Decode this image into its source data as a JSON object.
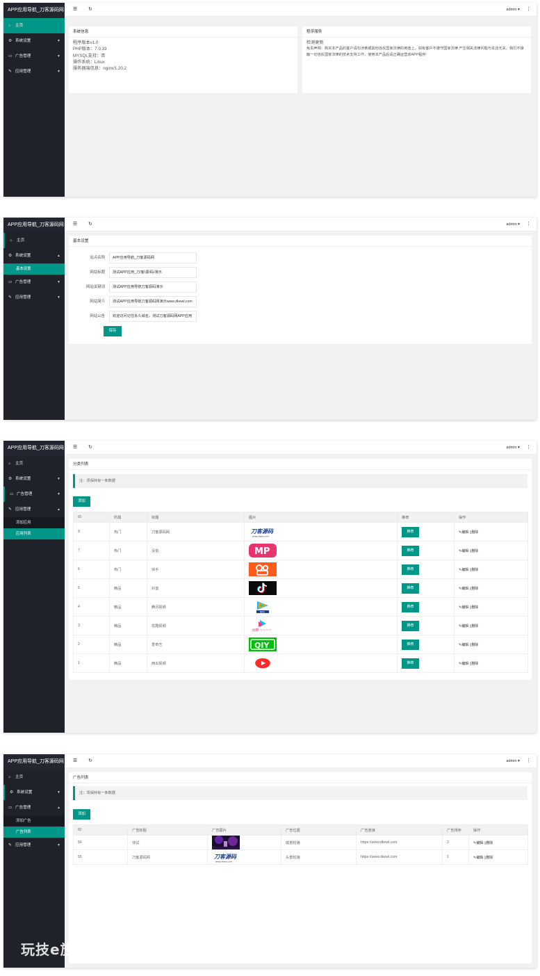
{
  "app": {
    "title": "APP应用导航_刀客源码网",
    "user": "admin ▾",
    "menu_icon": "hamburger-icon",
    "refresh_icon": "refresh-icon",
    "more_icon": "more-vert-icon"
  },
  "nav": {
    "home": "主页",
    "system": "系统设置",
    "ads": "广告管理",
    "apps": "应用管理",
    "sub_basic": "基本设置",
    "sub_add_app": "添加应用",
    "sub_app_list": "应用列表",
    "sub_add_ad": "添加广告",
    "sub_ad_list": "广告列表"
  },
  "dashboard": {
    "sysinfo_title": "系统信息",
    "sysinfo_lines": [
      "程序版本v1.0",
      "PHP版本：7.0.33",
      "MYSQL支持：否",
      "操作系统：Linux",
      "服务器端信息：nginx/1.20.2"
    ],
    "service_title": "程序服务",
    "service_update": "检测更新",
    "service_disclaimer": "免责声明：购买本产品的客户请勿涉黄或其他违反国家法律的用途上，如有客户不遵守国家法律 产生相关法律问题与本店无关，我们不接触一切违反国家法律的技术支持工作，使用本产品后请正确运营该APP程序!"
  },
  "settings": {
    "title": "基本设置",
    "fields": [
      {
        "label": "站点名称",
        "value": "APP应用导航_刀客源码网"
      },
      {
        "label": "网站标题",
        "value": "测试APP应用_刀/客/源/码/演示"
      },
      {
        "label": "网站关键词",
        "value": "测试APP应用导航刀客源码演示"
      },
      {
        "label": "网站简介",
        "value": "测试APP应用导航刀客源码网演示www.dkewl.com"
      },
      {
        "label": "网站公告",
        "value": "欢迎访问记住永久域名，测试刀客源码网APP应用"
      }
    ],
    "save": "保存"
  },
  "app_list": {
    "title": "分类列表",
    "tip": "注：须保持有一条数据",
    "add": "添加",
    "headers": [
      "ID",
      "所属",
      "标题",
      "图片",
      "推荐",
      "操作"
    ],
    "rows": [
      {
        "id": "9",
        "cat": "热门",
        "title": "刀客源码网",
        "img": "dk-logo",
        "rec": "推荐",
        "ops": "✎编辑 ▯删除"
      },
      {
        "id": "7",
        "cat": "热门",
        "title": "没拍",
        "img": "mp-logo",
        "rec": "推荐",
        "ops": "✎编辑 ▯删除"
      },
      {
        "id": "6",
        "cat": "热门",
        "title": "快手",
        "img": "kuaishou-logo",
        "rec": "推荐",
        "ops": "✎编辑 ▯删除"
      },
      {
        "id": "5",
        "cat": "精品",
        "title": "抖音",
        "img": "douyin-logo",
        "rec": "推荐",
        "ops": "✎编辑 ▯删除"
      },
      {
        "id": "4",
        "cat": "精品",
        "title": "腾讯视频",
        "img": "tencent-video-logo",
        "rec": "推荐",
        "ops": "✎编辑 ▯删除"
      },
      {
        "id": "3",
        "cat": "精品",
        "title": "优酷视频",
        "img": "youku-logo",
        "rec": "推荐",
        "ops": "✎编辑 ▯删除"
      },
      {
        "id": "2",
        "cat": "精品",
        "title": "爱奇艺",
        "img": "iqiyi-logo",
        "rec": "推荐",
        "ops": "✎编辑 ▯删除"
      },
      {
        "id": "1",
        "cat": "精品",
        "title": "西瓜视频",
        "img": "xigua-logo",
        "rec": "推荐",
        "ops": "✎编辑 ▯删除"
      }
    ]
  },
  "ad_list": {
    "title": "广告列表",
    "tip": "注：须保持有一条数据",
    "add": "添加",
    "headers": [
      "ID",
      "广告标题",
      "广告图片",
      "广告位置",
      "广告连接",
      "广告排序",
      "操作"
    ],
    "rows": [
      {
        "id": "56",
        "title": "测试",
        "img": "concert-image",
        "pos": "底部轮播",
        "url": "https://www.dkewl.com",
        "sort": "2",
        "ops": "✎编辑 ▯删除"
      },
      {
        "id": "55",
        "title": "刀客源码网",
        "img": "dk-logo",
        "pos": "头部轮播",
        "url": "https://www.dkewl.com",
        "sort": "1",
        "ops": "✎编辑 ▯删除"
      }
    ]
  },
  "logos": {
    "dk": "刀客源码",
    "dk_sub": "www.dkewl.com",
    "mp": "MP",
    "iqiyi": "QIY",
    "youku": "优酷",
    "tencent": "NBA"
  },
  "watermark": "玩技e族",
  "colors": {
    "accent": "#009688",
    "sidebar": "#20222a"
  }
}
